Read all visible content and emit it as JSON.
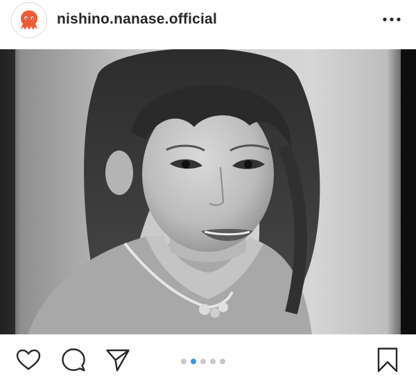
{
  "post": {
    "username": "nishino.nanase.official",
    "avatar_icon": "octopus-icon",
    "more_icon": "more-options-icon"
  },
  "photo": {
    "style": "black-and-white portrait"
  },
  "actions": {
    "like_icon": "heart-icon",
    "comment_icon": "comment-icon",
    "share_icon": "send-icon",
    "save_icon": "bookmark-icon"
  },
  "carousel": {
    "total": 5,
    "active": 2
  },
  "colors": {
    "accent": "#3897f0",
    "avatar": "#ef5b34",
    "inactive_dot": "#c8c8c8"
  }
}
